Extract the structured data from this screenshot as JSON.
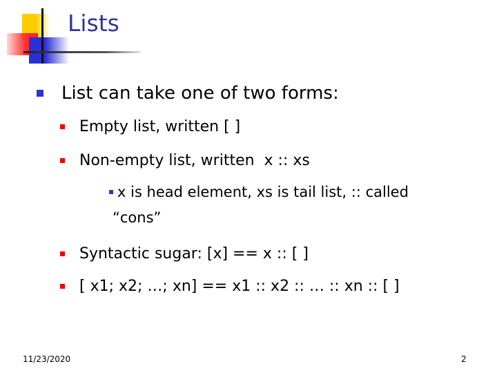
{
  "slide": {
    "title": "Lists",
    "bullets": [
      {
        "level": 1,
        "text": "List can take one of two forms:"
      },
      {
        "level": 2,
        "text": "Empty list, written [ ]"
      },
      {
        "level": 2,
        "text": "Non-empty list, written  x :: xs"
      },
      {
        "level": 3,
        "text": "x is head element, xs is tail list, :: called",
        "continuation": "“cons”"
      },
      {
        "level": 2,
        "text": "Syntactic sugar: [x] == x :: [ ]"
      },
      {
        "level": 2,
        "text": "[ x1; x2; …; xn] == x1 :: x2 :: … :: xn :: [ ]"
      }
    ]
  },
  "footer": {
    "date": "11/23/2020",
    "page_number": "2"
  },
  "colors": {
    "title": "#333399",
    "bullet_level1": "#3333cc",
    "bullet_level2": "#ee0000",
    "bullet_level3": "#3333cc"
  }
}
